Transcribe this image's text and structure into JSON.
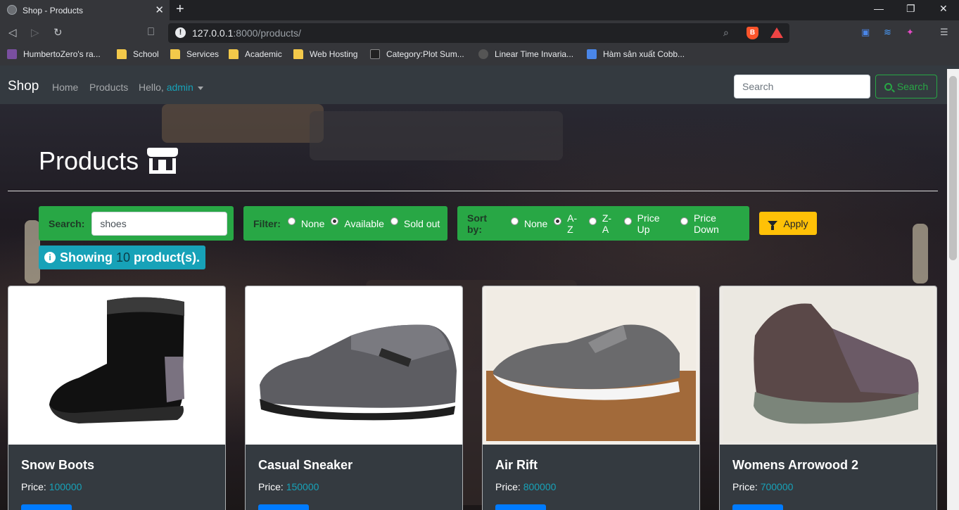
{
  "browser": {
    "tab_title": "Shop - Products",
    "url_host": "127.0.0.1",
    "url_rest": ":8000/products/",
    "brave_label": "B",
    "bookmarks": [
      {
        "label": "HumbertoZero's ra...",
        "icon": "avatar-icon",
        "color": "#7a4fa0"
      },
      {
        "label": "School",
        "icon": "folder-icon",
        "color": "#f3c94a"
      },
      {
        "label": "Services",
        "icon": "folder-icon",
        "color": "#f3c94a"
      },
      {
        "label": "Academic",
        "icon": "folder-icon",
        "color": "#f3c94a"
      },
      {
        "label": "Web Hosting",
        "icon": "folder-icon",
        "color": "#f3c94a"
      },
      {
        "label": "Category:Plot Sum...",
        "icon": "wiki-icon",
        "color": "#222"
      },
      {
        "label": "Linear Time Invaria...",
        "icon": "globe-icon",
        "color": "#555"
      },
      {
        "label": "Hàm sản xuất Cobb...",
        "icon": "doc-icon",
        "color": "#4a86e8"
      }
    ]
  },
  "navbar": {
    "brand": "Shop",
    "home": "Home",
    "products": "Products",
    "hello": "Hello,",
    "user": "admin",
    "search_placeholder": "Search",
    "search_button": "Search"
  },
  "page": {
    "heading": "Products",
    "search_label": "Search:",
    "search_value": "shoes",
    "filter_label": "Filter:",
    "filter_options": [
      "None",
      "Available",
      "Sold out"
    ],
    "filter_selected": "Available",
    "sort_label": "Sort by:",
    "sort_options": [
      "None",
      "A-Z",
      "Z-A",
      "Price Up",
      "Price Down"
    ],
    "sort_selected": "A-Z",
    "apply_label": "Apply",
    "showing_prefix": "Showing",
    "showing_count": "10",
    "showing_suffix": "product(s).",
    "price_label": "Price:"
  },
  "products": [
    {
      "name": "Snow Boots",
      "price": "100000"
    },
    {
      "name": "Casual Sneaker",
      "price": "150000"
    },
    {
      "name": "Air Rift",
      "price": "800000"
    },
    {
      "name": "Womens Arrowood 2",
      "price": "700000"
    }
  ],
  "colors": {
    "success": "#28a745",
    "info": "#17a2b8",
    "warning": "#ffc107",
    "primary": "#007bff",
    "navbar": "#343a40"
  }
}
